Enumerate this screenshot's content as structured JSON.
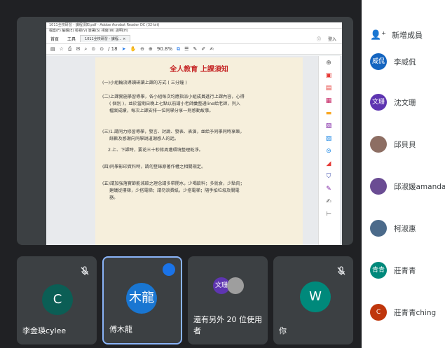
{
  "meeting": {
    "screen_share": {
      "window_title": "1011全校研習 - 課程須知.pdf - Adobe Acrobat Reader DC (32-bit)",
      "menu": "檔案(F)  編輯(E)  檢視(V)  簽署(S)  視窗(W)  說明(H)",
      "tabs": [
        "首頁",
        "工具"
      ],
      "doc_tab": "1011全校研習 - 課程... ×",
      "toolbar_page": "/ 18",
      "toolbar_zoom": "90.8%",
      "tab_right": "登入",
      "document": {
        "title": "全人教育 上課須知",
        "lines": [
          "(一)小組輪流導讀研讀上課的方式 ( 三分鐘 )",
          "(二)上課實施學習導學，各小組每次均應指派小組成員進行上課內容，心得",
          "( 個別 )，並於當期日晚上七點以前請小老師彙整通line給老師，列入",
          "檔案成績，每次上課安排一位同學分享一則感動故事。",
          "(三)1.請同力修習導學，發言、討論、發表、表演，並給予同學同時享樂，",
          "餘數及感謝向同學說道謝感人的話。",
          "2.上、下課時，要花三十秒將周遭環境整理乾淨。",
          "(四)同學影印資料時，請勿登錄原著作權之相關規定。",
          "(五)請加強落實節能減碳之理念請多帶開水，少喝飲料；多就食，少點肉；",
          "建議從樓梯，少搭電梯；請勿浪費紙，少搭電梯；隨手拍垃圾及關電",
          "器。"
        ]
      }
    },
    "tiles": [
      {
        "name": "李金瑛cylee",
        "initial": "C",
        "avatar_color": "#0b5e55",
        "muted": true
      },
      {
        "name": "傅木龍",
        "initial": "木龍",
        "avatar_color": "#1976d2",
        "speaking": true
      },
      {
        "name": "還有另外 20 位使用者",
        "badge": "文珊",
        "badge_color": "#5e35b1"
      },
      {
        "name": "你",
        "initial": "W",
        "avatar_color": "#00897b",
        "muted": true
      }
    ]
  },
  "people_panel": {
    "add_label": "新增成員",
    "members": [
      {
        "name": "李威侃",
        "initial": "威侃",
        "color": "#1565c0"
      },
      {
        "name": "沈文珊",
        "initial": "文珊",
        "color": "#5e35b1"
      },
      {
        "name": "邱貝貝",
        "initial": "",
        "color": "#8d6e63"
      },
      {
        "name": "邱淑媛amanda",
        "initial": "",
        "color": "#6a4c93"
      },
      {
        "name": "柯淑惠",
        "initial": "",
        "color": "#4b6a8a"
      },
      {
        "name": "莊青青",
        "initial": "青青",
        "color": "#00897b"
      },
      {
        "name": "莊青青ching",
        "initial": "C",
        "color": "#bf360c"
      }
    ]
  }
}
